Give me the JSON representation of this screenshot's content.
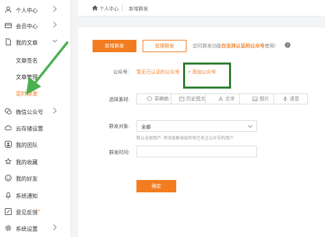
{
  "sidebar": {
    "items": [
      {
        "icon": "user-icon",
        "label": "个人中心"
      },
      {
        "icon": "credit-card-icon",
        "label": "会员中心"
      },
      {
        "icon": "file-icon",
        "label": "我的文章"
      },
      {
        "label": "文章签名"
      },
      {
        "label": "文章管理"
      },
      {
        "label": "定时群发"
      },
      {
        "icon": "wechat-icon",
        "label": "微信公众号"
      },
      {
        "icon": "cloud-icon",
        "label": "云存储设置"
      },
      {
        "icon": "team-icon",
        "label": "我的团队"
      },
      {
        "icon": "star-icon",
        "label": "我的收藏"
      },
      {
        "icon": "friend-icon",
        "label": "我的好友"
      },
      {
        "icon": "bell-icon",
        "label": "系统通知"
      },
      {
        "icon": "feedback-icon",
        "label": "意见反馈",
        "badge": "•"
      },
      {
        "icon": "gear-icon",
        "label": "系统设置"
      }
    ]
  },
  "breadcrumb": {
    "home": "个人中心",
    "current": "新增群发"
  },
  "toolbar": {
    "new_label": "新增群发",
    "manage_label": "管理群发",
    "notice_prefix": "定时群发功能",
    "notice_highlight": "仅支持认证的公众号",
    "notice_suffix": "使用!"
  },
  "form": {
    "account_label": "公众号:",
    "account_none": "暂无已认证的公众号",
    "account_add": "+ 添加公众号",
    "material_label": "选择素材:",
    "material_types": [
      "草稿箱",
      "历史图文",
      "文字",
      "图片",
      "语音"
    ],
    "target_label": "群发对象:",
    "target_value": "全部",
    "target_hint": "默认全部用户, 将消息群发给所有已关注公众号的用户",
    "time_label": "群发时间:",
    "confirm_label": "确定"
  },
  "colors": {
    "accent": "#f47c20",
    "highlight_box": "#2e7d32",
    "arrow": "#4caf50"
  }
}
